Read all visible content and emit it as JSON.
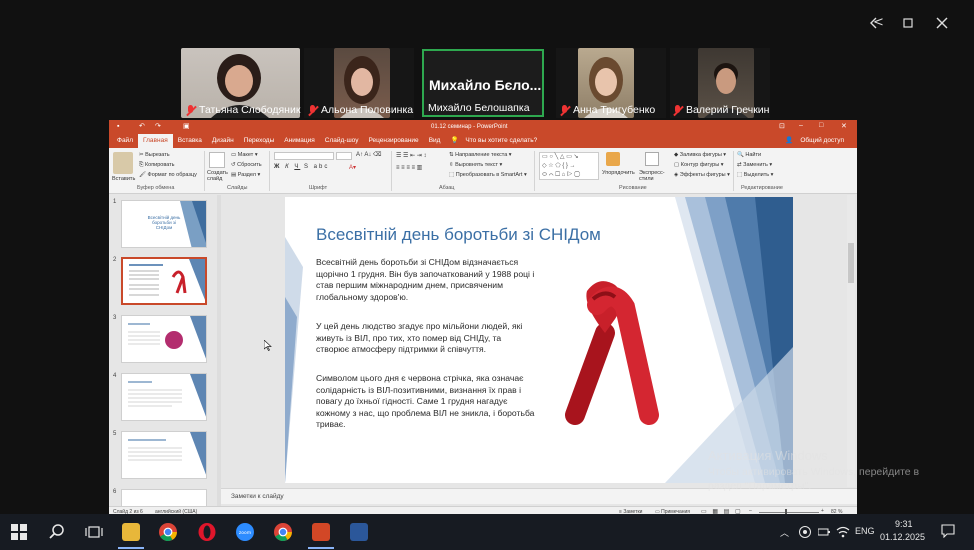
{
  "window_controls": [
    "<",
    "–",
    "□",
    "✕"
  ],
  "participants": [
    {
      "name": "Татьяна Слободяник",
      "muted": true
    },
    {
      "name": "Альона Половинка",
      "muted": true
    },
    {
      "name": "Михайло Белошапка",
      "big_name": "Михайло Бєло...",
      "muted": false,
      "active_speaker": true
    },
    {
      "name": "Анна Тригубенко",
      "muted": true
    },
    {
      "name": "Валерий Гречкин",
      "muted": true
    }
  ],
  "powerpoint": {
    "title": "01.12 семинар - PowerPoint",
    "tabs": [
      "Файл",
      "Главная",
      "Вставка",
      "Дизайн",
      "Переходы",
      "Анимация",
      "Слайд-шоу",
      "Рецензирование",
      "Вид"
    ],
    "active_tab": "Главная",
    "tell_me": "Что вы хотите сделать?",
    "share": "Общий доступ",
    "ribbon": {
      "paste": "Вставить",
      "cut": "Вырезать",
      "copy": "Копировать",
      "format_painter": "Формат по образцу",
      "clipboard": "Буфер обмена",
      "new_slide": "Создать слайд",
      "layout": "Макет",
      "reset": "Сбросить",
      "section": "Раздел",
      "slides": "Слайды",
      "font": "Шрифт",
      "text_direction": "Направление текста",
      "align_text": "Выровнять текст",
      "smartart": "Преобразовать в SmartArt",
      "paragraph": "Абзац",
      "arrange": "Упорядочить",
      "quick_styles": "Экспресс-стили",
      "shape_fill": "Заливка фигуры",
      "shape_outline": "Контур фигуры",
      "shape_effects": "Эффекты фигуры",
      "drawing": "Рисование",
      "find": "Найти",
      "replace": "Заменить",
      "select": "Выделить",
      "editing": "Редактирование"
    },
    "slide": {
      "title": "Всесвітній день боротьби зі СНІДом",
      "paragraphs": [
        "Всесвітній день боротьби зі СНІДом відзначається щорічно 1 грудня. Він був започаткований у 1988 році і став першим міжнародним днем, присвяченим глобальному здоров'ю.",
        "У цей день людство згадує про мільйони людей, які живуть із ВІЛ, про тих, хто помер від СНІДу, та створює атмосферу підтримки й співчуття.",
        "Символом цього дня є червона стрічка, яка означає солідарність із ВІЛ-позитивними, визнання їх прав і повагу до їхньої гідності. Саме 1 грудня нагадує кожному з нас, що проблема ВІЛ не зникла, і боротьба триває."
      ]
    },
    "thumbnails": [
      "1",
      "2",
      "3",
      "4",
      "5",
      "6"
    ],
    "thumb1_title": "Всесвітній день боротьби зі СНІДом",
    "notes_placeholder": "Заметки к слайду",
    "status": {
      "slide": "Слайд 2 из 6",
      "lang": "английский (США)",
      "notes": "Заметки",
      "comments": "Примечания",
      "zoom": "82 %"
    }
  },
  "watermark": {
    "line1": "Активация Windows",
    "line2": "Чтобы активировать Windows, перейдите в",
    "line3": "раздел \"Параметры\"."
  },
  "taskbar": {
    "lang": "ENG",
    "time": "9:31",
    "date": "01.12.2025"
  },
  "colors": {
    "ppt_accent": "#c9492a",
    "title_blue": "#3b6fa5",
    "active_speaker_border": "#2ea84f"
  }
}
